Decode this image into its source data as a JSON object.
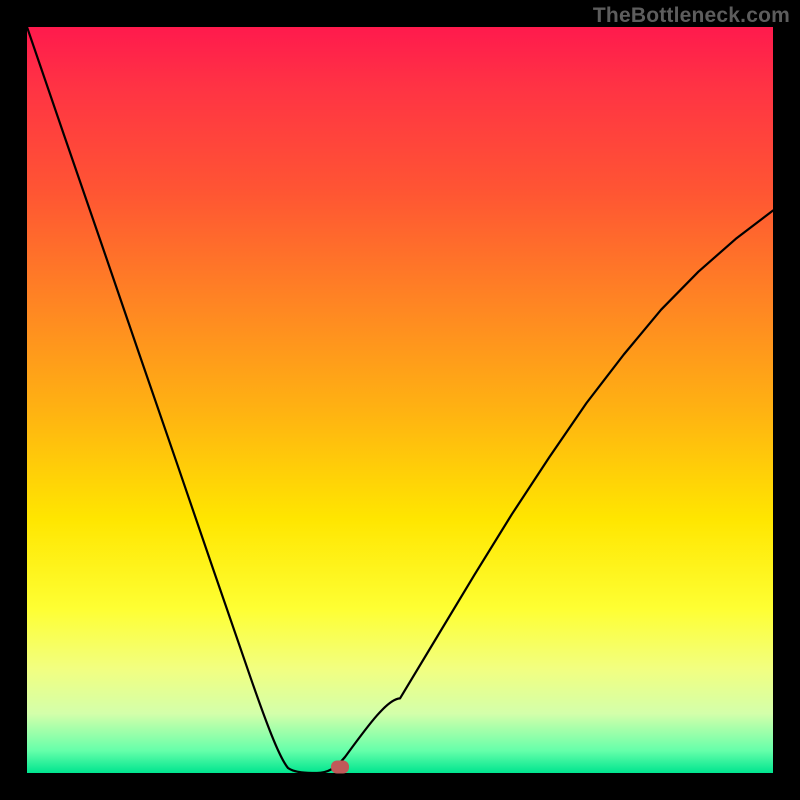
{
  "watermark": "TheBottleneck.com",
  "chart_data": {
    "type": "line",
    "title": "",
    "xlabel": "",
    "ylabel": "",
    "xlim": [
      0,
      100
    ],
    "ylim": [
      0,
      100
    ],
    "grid": false,
    "series": [
      {
        "name": "curve",
        "x": [
          5,
          10,
          15,
          20,
          25,
          30,
          35,
          38,
          40,
          41.5,
          43,
          45,
          50,
          55,
          60,
          65,
          70,
          75,
          80,
          85,
          90,
          95,
          100
        ],
        "y": [
          100,
          85.4,
          70.9,
          56.3,
          41.8,
          27.2,
          12.7,
          4.3,
          0.7,
          0,
          0,
          2.1,
          10,
          18.3,
          26.6,
          34.7,
          42.3,
          49.6,
          56.1,
          62.1,
          67.2,
          71.6,
          75.4
        ]
      }
    ],
    "marker": {
      "x": 42,
      "y": 0
    },
    "background_gradient": {
      "top_color": "#ff1a4d",
      "bottom_color": "#00e58f"
    }
  }
}
